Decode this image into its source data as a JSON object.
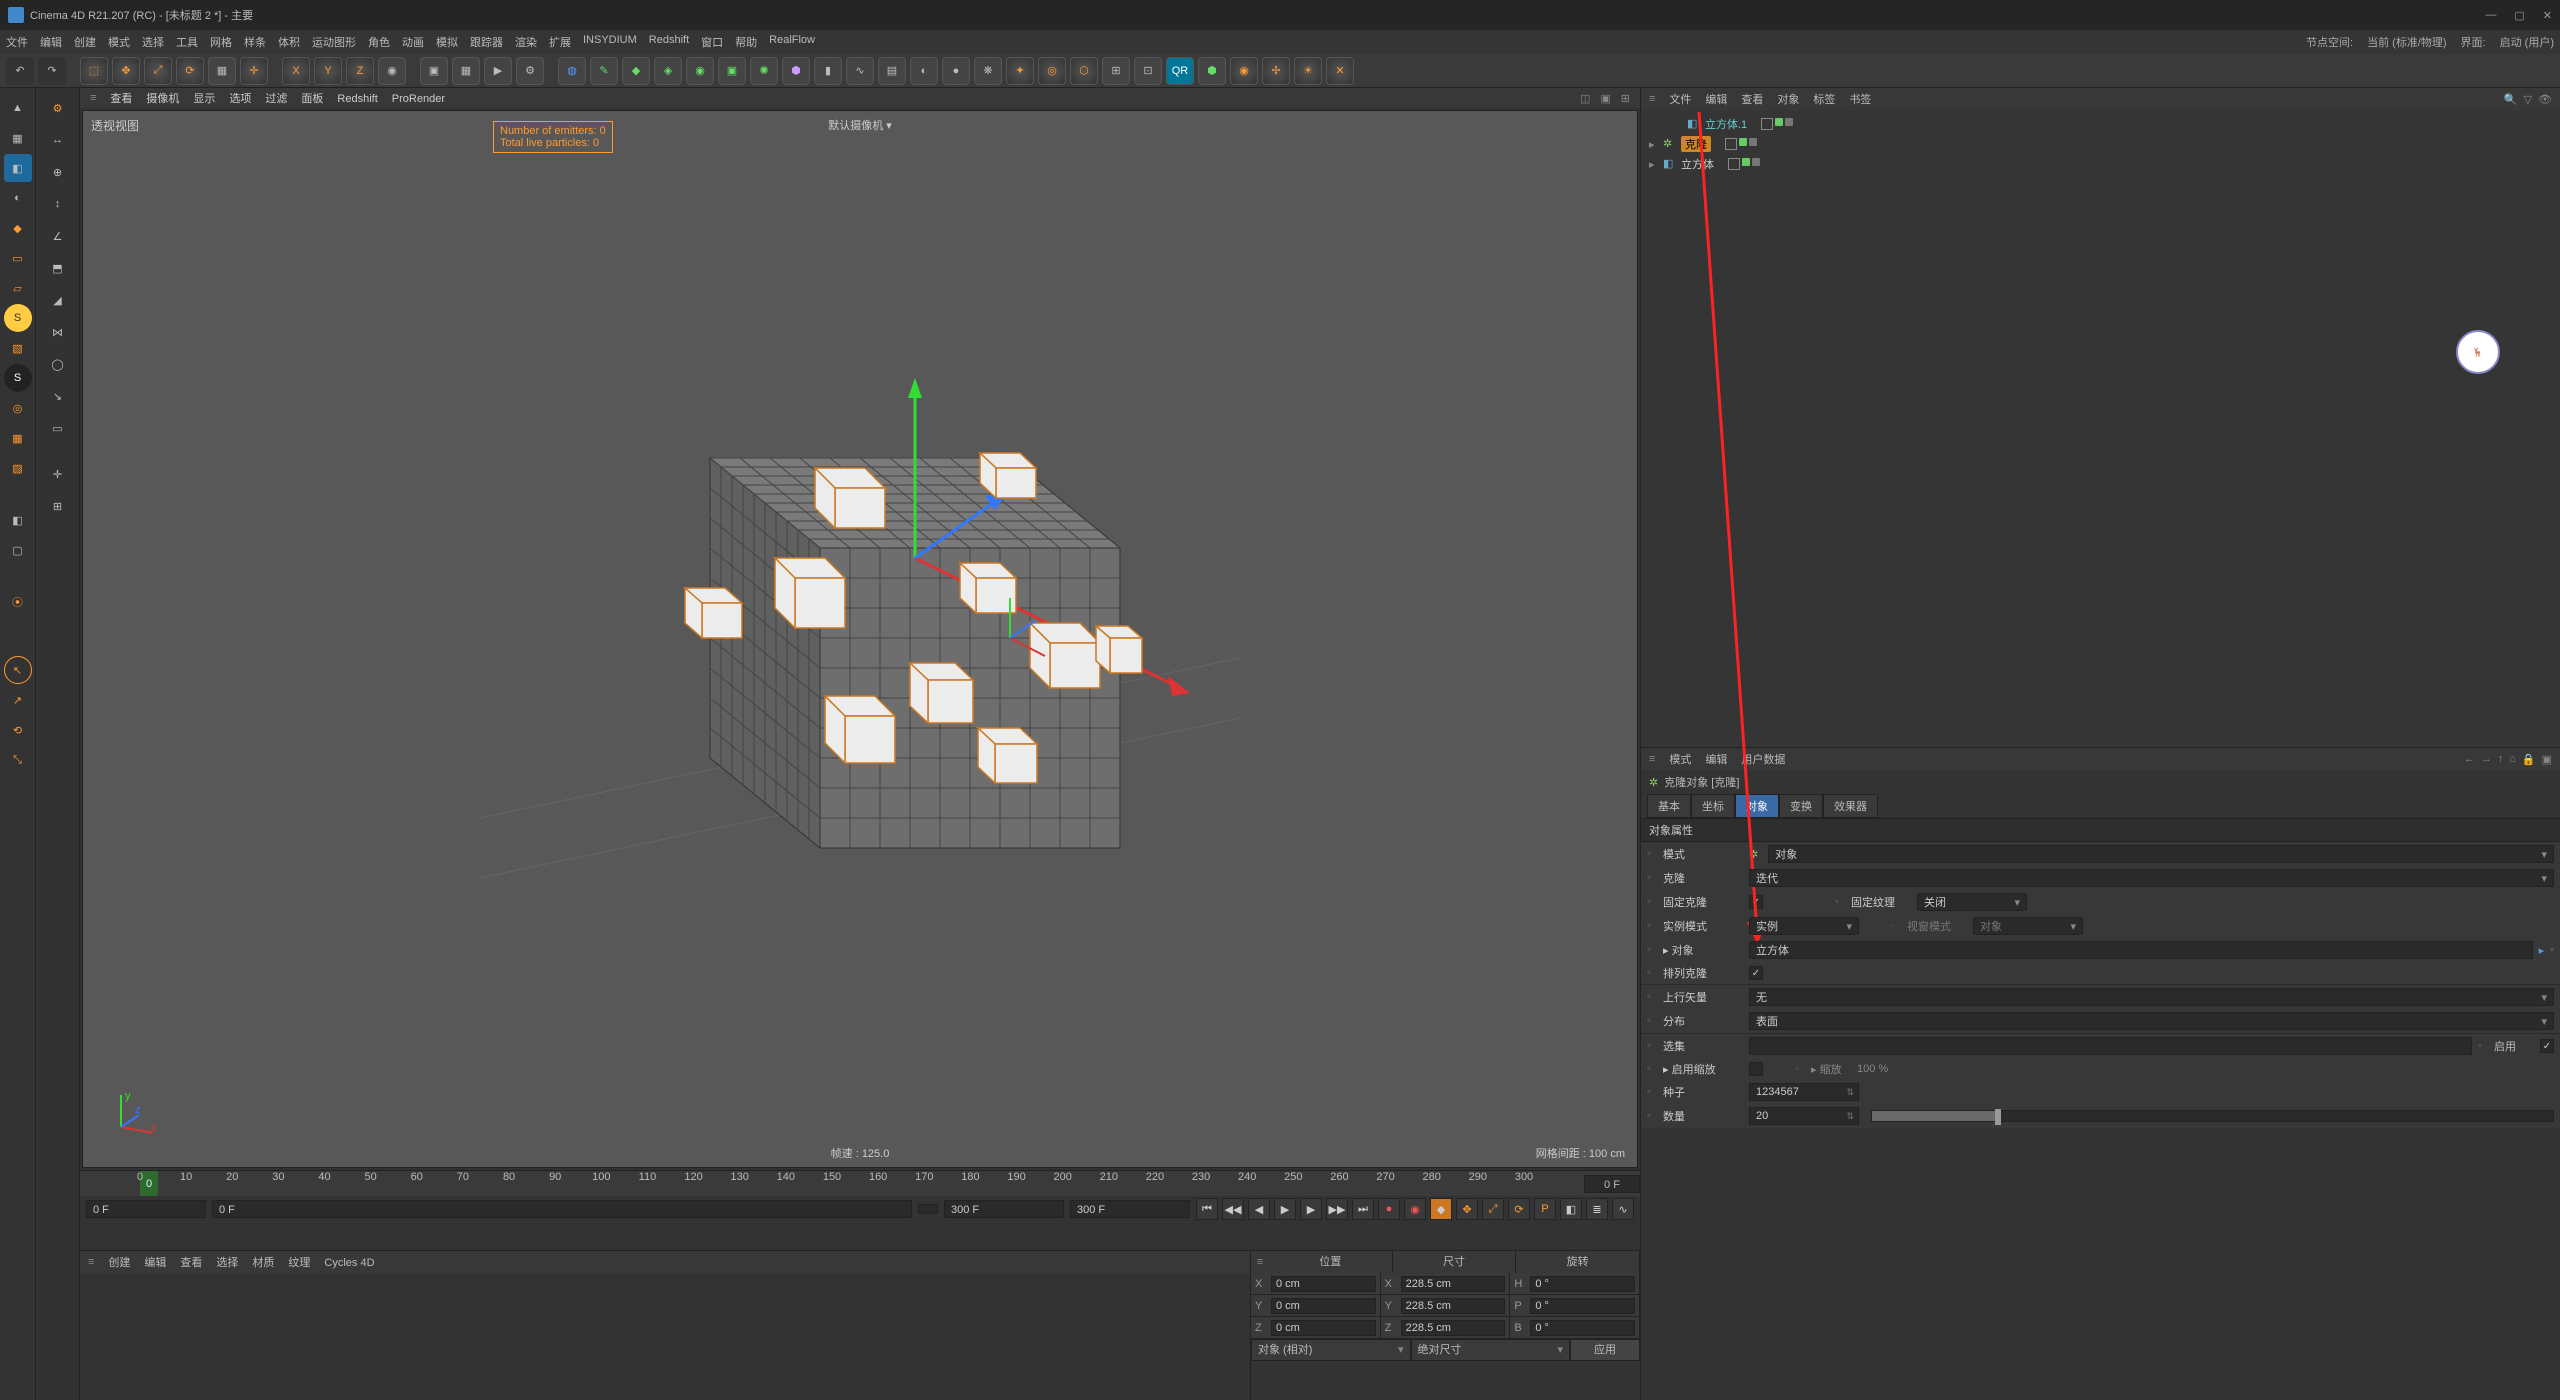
{
  "app": {
    "title": "Cinema 4D R21.207 (RC) - [未标题 2 *] - 主要",
    "win_min": "—",
    "win_max": "▢",
    "win_close": "✕"
  },
  "menu": {
    "items": [
      "文件",
      "编辑",
      "创建",
      "模式",
      "选择",
      "工具",
      "网格",
      "样条",
      "体积",
      "运动图形",
      "角色",
      "动画",
      "模拟",
      "跟踪器",
      "渲染",
      "扩展",
      "INSYDIUM",
      "Redshift",
      "窗口",
      "帮助",
      "RealFlow"
    ],
    "right": {
      "node_space_lbl": "节点空间:",
      "node_space_val": "当前 (标准/物理)",
      "ui_lbl": "界面:",
      "ui_val": "启动 (用户)"
    }
  },
  "viewport": {
    "menu": [
      "查看",
      "摄像机",
      "显示",
      "选项",
      "过滤",
      "面板",
      "Redshift",
      "ProRender"
    ],
    "label": "透视视图",
    "camera": "默认摄像机 ▾",
    "hud1": "Number of emitters: 0",
    "hud2": "Total live particles: 0",
    "status_fps": "帧速 : 125.0",
    "status_grid": "网格间距 : 100 cm"
  },
  "objects_panel": {
    "menu": [
      "文件",
      "编辑",
      "查看",
      "对象",
      "标签",
      "书签"
    ],
    "tree": [
      {
        "name": "立方体",
        "lvl": 0,
        "color": "#66aacc",
        "sel": false,
        "icon": "cube"
      },
      {
        "name": "克隆",
        "lvl": 0,
        "color": "#cc8822",
        "sel": true,
        "icon": "cloner"
      },
      {
        "name": "立方体.1",
        "lvl": 1,
        "color": "#66aacc",
        "sel": false,
        "icon": "cube",
        "teal": true
      }
    ]
  },
  "attributes": {
    "menu": [
      "模式",
      "编辑",
      "用户数据"
    ],
    "object_head": "克隆对象 [克隆]",
    "tabs": [
      "基本",
      "坐标",
      "对象",
      "变换",
      "效果器"
    ],
    "active_tab": 2,
    "section_title": "对象属性",
    "mode_lbl": "模式",
    "mode_val": "对象",
    "clone_lbl": "克隆",
    "clone_val": "迭代",
    "fixclone_lbl": "固定克隆",
    "fixclone_on": true,
    "fixtex_lbl": "固定纹理",
    "fixtex_val": "关闭",
    "inst_lbl": "实例模式",
    "inst_val": "实例",
    "viewmode_lbl": "视窗模式",
    "viewmode_val": "对象",
    "obj_lbl": "▸ 对象",
    "obj_val": "立方体",
    "arr_lbl": "排列克隆",
    "arr_on": true,
    "up_lbl": "上行矢量",
    "up_val": "无",
    "dist_lbl": "分布",
    "dist_val": "表面",
    "sel_lbl": "选集",
    "sel_val": "",
    "enable_lbl": "启用",
    "enable_on": true,
    "scale_en_lbl": "▸ 启用缩放",
    "scale_en_on": false,
    "scale_lbl": "▸ 缩放",
    "scale_val": "100 %",
    "seed_lbl": "种子",
    "seed_val": "1234567",
    "count_lbl": "数量",
    "count_val": "20",
    "count_pct": 18
  },
  "timeline": {
    "start": "0",
    "end": "300",
    "cur": "0",
    "lbl_start": "0 F",
    "lbl_end": "300 F",
    "lbl_cur": "0 F",
    "lbl_cur2": "300 F",
    "ticks": [
      "0",
      "10",
      "20",
      "30",
      "40",
      "50",
      "60",
      "70",
      "80",
      "90",
      "100",
      "110",
      "120",
      "130",
      "140",
      "150",
      "160",
      "170",
      "180",
      "190",
      "200",
      "210",
      "220",
      "230",
      "240",
      "250",
      "260",
      "270",
      "280",
      "290",
      "300"
    ]
  },
  "materials": {
    "menu": [
      "创建",
      "编辑",
      "查看",
      "选择",
      "材质",
      "纹理",
      "Cycles 4D"
    ]
  },
  "coords": {
    "cols": [
      "位置",
      "尺寸",
      "旋转"
    ],
    "rows": [
      {
        "k1": "X",
        "v1": "0 cm",
        "k2": "X",
        "v2": "228.5 cm",
        "k3": "H",
        "v3": "0 °"
      },
      {
        "k1": "Y",
        "v1": "0 cm",
        "k2": "Y",
        "v2": "228.5 cm",
        "k3": "P",
        "v3": "0 °"
      },
      {
        "k1": "Z",
        "v1": "0 cm",
        "k2": "Z",
        "v2": "228.5 cm",
        "k3": "B",
        "v3": "0 °"
      }
    ],
    "dd1": "对象 (相对)",
    "dd2": "绝对尺寸",
    "apply": "应用"
  }
}
